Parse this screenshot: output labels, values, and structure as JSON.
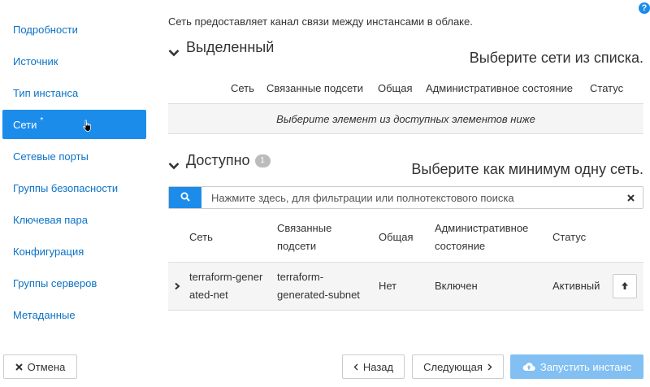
{
  "help_label": "?",
  "sidebar": {
    "items": [
      {
        "label": "Подробности"
      },
      {
        "label": "Источник"
      },
      {
        "label": "Тип инстанса"
      },
      {
        "label": "Сети",
        "required": "*"
      },
      {
        "label": "Сетевые порты"
      },
      {
        "label": "Группы безопасности"
      },
      {
        "label": "Ключевая пара"
      },
      {
        "label": "Конфигурация"
      },
      {
        "label": "Группы серверов"
      },
      {
        "label": "Метаданные"
      }
    ]
  },
  "main": {
    "intro": "Сеть предоставляет канал связи между инстансами в облаке.",
    "allocated": {
      "title": "Выделенный",
      "hint": "Выберите сети из списка.",
      "columns": [
        "Сеть",
        "Связанные подсети",
        "Общая",
        "Административное состояние",
        "Статус"
      ],
      "empty_text": "Выберите элемент из доступных элементов ниже"
    },
    "available": {
      "title": "Доступно",
      "count": "1",
      "hint": "Выберите как минимум одну сеть.",
      "search_placeholder": "Нажмите здесь, для фильтрации или полнотекстового поиска",
      "columns": [
        "Сеть",
        "Связанные подсети",
        "Общая",
        "Административное состояние",
        "Статус"
      ],
      "rows": [
        {
          "network": "terraform-generated-net",
          "subnets": "terraform-generated-subnet",
          "shared": "Нет",
          "admin_state": "Включен",
          "status": "Активный"
        }
      ]
    }
  },
  "footer": {
    "cancel": "Отмена",
    "back": "Назад",
    "next": "Следующая",
    "launch": "Запустить инстанс"
  },
  "colors": {
    "accent": "#1c8ceb",
    "link": "#0a72c6",
    "launch_disabled": "#82bff2"
  }
}
